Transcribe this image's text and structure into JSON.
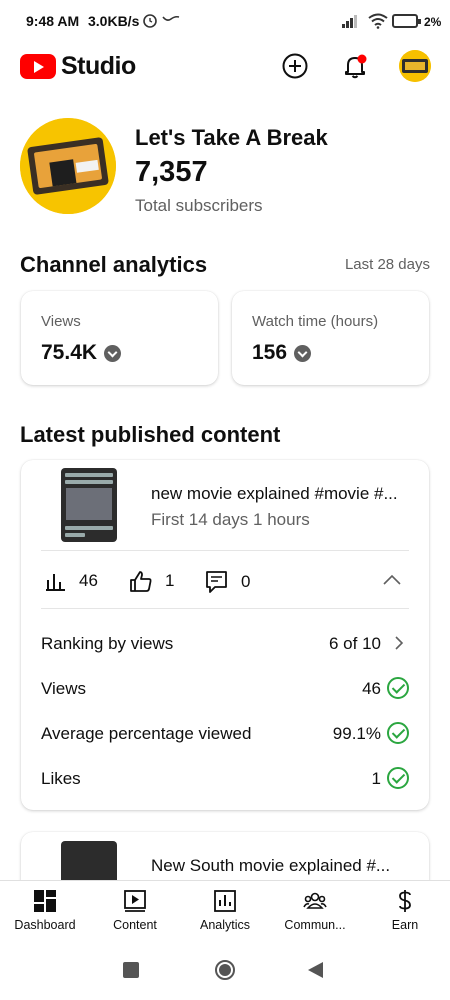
{
  "status_bar": {
    "time": "9:48 AM",
    "speed": "3.0KB/s",
    "battery": "2%"
  },
  "app": {
    "logo_text": "Studio"
  },
  "channel": {
    "name": "Let's Take A Break",
    "subscribers": "7,357",
    "subscribers_label": "Total subscribers"
  },
  "analytics": {
    "title": "Channel analytics",
    "period": "Last 28 days",
    "views_label": "Views",
    "views_value": "75.4K",
    "watch_label": "Watch time (hours)",
    "watch_value": "156"
  },
  "latest": {
    "title": "Latest published content",
    "video_title": "new movie explained #movie #...",
    "video_sub": "First 14 days 1 hours",
    "stats": {
      "views": "46",
      "likes": "1",
      "comments": "0"
    },
    "details": [
      {
        "label": "Ranking by views",
        "value": "6 of 10"
      },
      {
        "label": "Views",
        "value": "46"
      },
      {
        "label": "Average percentage viewed",
        "value": "99.1%"
      },
      {
        "label": "Likes",
        "value": "1"
      }
    ],
    "next_video_title": "New South movie explained #..."
  },
  "bottom_nav": [
    {
      "label": "Dashboard",
      "icon": "dashboard-icon"
    },
    {
      "label": "Content",
      "icon": "content-icon"
    },
    {
      "label": "Analytics",
      "icon": "analytics-icon"
    },
    {
      "label": "Commun...",
      "icon": "community-icon"
    },
    {
      "label": "Earn",
      "icon": "earn-icon"
    }
  ],
  "colors": {
    "brand_red": "#ff0000",
    "check_green": "#2ba640",
    "notification_dot": "#ff0000"
  }
}
